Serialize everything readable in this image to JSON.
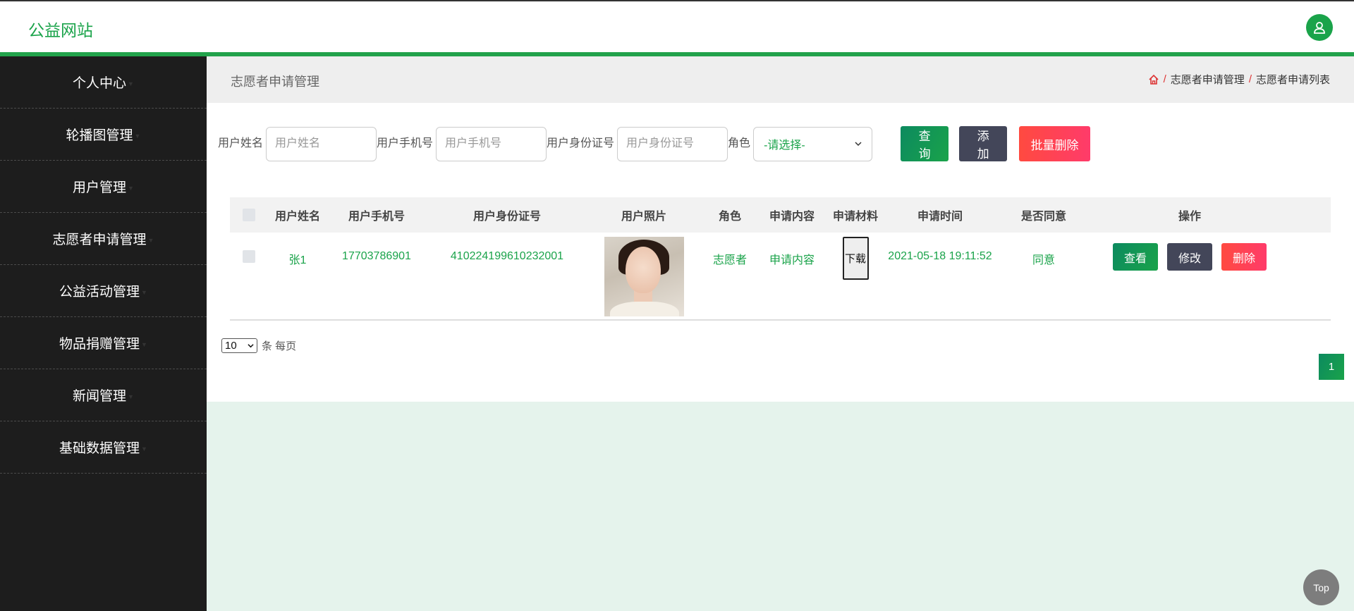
{
  "header": {
    "site_title": "公益网站",
    "avatar_icon": "user-icon"
  },
  "sidebar": {
    "items": [
      {
        "label": "个人中心"
      },
      {
        "label": "轮播图管理"
      },
      {
        "label": "用户管理"
      },
      {
        "label": "志愿者申请管理"
      },
      {
        "label": "公益活动管理"
      },
      {
        "label": "物品捐赠管理"
      },
      {
        "label": "新闻管理"
      },
      {
        "label": "基础数据管理"
      }
    ]
  },
  "page": {
    "title": "志愿者申请管理",
    "breadcrumb": {
      "sep": "/",
      "level1": "志愿者申请管理",
      "level2": "志愿者申请列表"
    }
  },
  "search": {
    "name_label": "用户姓名",
    "name_placeholder": "用户姓名",
    "phone_label": "用户手机号",
    "phone_placeholder": "用户手机号",
    "idcard_label": "用户身份证号",
    "idcard_placeholder": "用户身份证号",
    "role_label": "角色",
    "role_selected": "-请选择-",
    "query_button": "查询",
    "add_button": "添加",
    "batch_delete_button": "批量删除"
  },
  "table": {
    "headers": [
      "用户姓名",
      "用户手机号",
      "用户身份证号",
      "用户照片",
      "角色",
      "申请内容",
      "申请材料",
      "申请时间",
      "是否同意",
      "操作"
    ],
    "rows": [
      {
        "name": "张1",
        "phone": "17703786901",
        "idcard": "410224199610232001",
        "role": "志愿者",
        "content": "申请内容",
        "material_button": "下载",
        "time": "2021-05-18 19:11:52",
        "agree": "同意",
        "view_button": "查看",
        "edit_button": "修改",
        "delete_button": "删除"
      }
    ]
  },
  "pagination": {
    "page_size": "10",
    "page_size_label": "条 每页",
    "current_page": "1"
  },
  "back_to_top": "Top",
  "colors": {
    "accent": "#1aa34a",
    "sidebar_bg": "#1d1d1d",
    "danger": "#ff4a40",
    "dark_button": "#434659"
  }
}
